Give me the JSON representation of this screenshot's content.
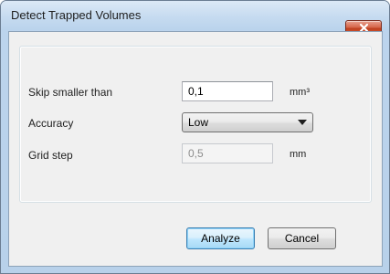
{
  "window": {
    "title": "Detect Trapped Volumes",
    "close_icon": "close-x-icon"
  },
  "form": {
    "skip": {
      "label": "Skip smaller than",
      "value": "0,1",
      "unit": "mm³"
    },
    "accuracy": {
      "label": "Accuracy",
      "selected": "Low",
      "arrow_icon": "chevron-down-icon"
    },
    "grid_step": {
      "label": "Grid step",
      "value": "0,5",
      "unit": "mm",
      "enabled": false
    }
  },
  "buttons": {
    "analyze_label": "Analyze",
    "cancel_label": "Cancel"
  },
  "colors": {
    "title_bar": "#c6dbf0",
    "close_button": "#c0411f",
    "dialog_bg": "#f0f0f0",
    "default_button_border": "#3c7fb1"
  }
}
